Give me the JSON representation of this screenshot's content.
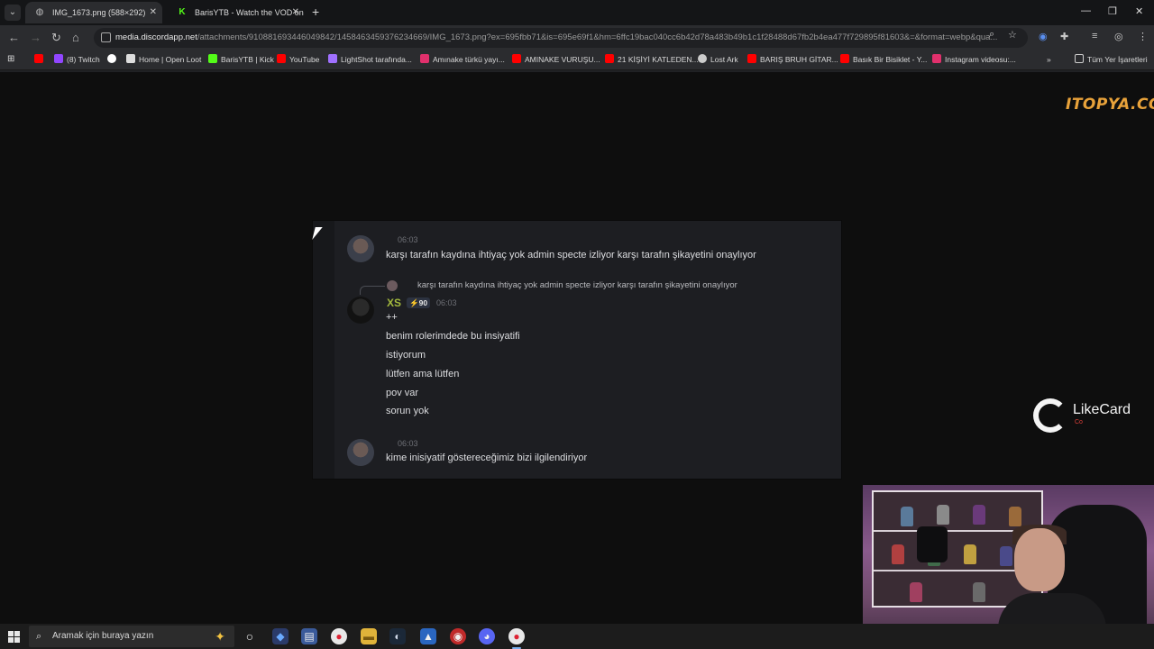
{
  "browser": {
    "tabs": [
      {
        "title": "IMG_1673.png (588×292)",
        "favicon": "globe-icon"
      },
      {
        "title": "BarisYTB - Watch the VOD on K",
        "favicon": "kick-icon"
      }
    ],
    "url_host": "media.discordapp.net",
    "url_path": "/attachments/910881693446049842/1458463459376234669/IMG_1673.png?ex=695fbb71&is=695e69f1&hm=6ffc19bac040cc6b42d78a483b49b1c1f28488d67fb2b4ea477f729895f81603&=&format=webp&qua...",
    "bookmarks": [
      {
        "label": "",
        "icon": "youtube-icon",
        "color": "#ff0000"
      },
      {
        "label": "(8) Twitch",
        "icon": "twitch-icon",
        "color": "#9146ff"
      },
      {
        "label": "",
        "icon": "google-icon",
        "color": "#ffffff"
      },
      {
        "label": "Home | Open Loot",
        "icon": "openloot-icon",
        "color": "#dddddd"
      },
      {
        "label": "BarisYTB | Kick",
        "icon": "kick-icon",
        "color": "#53fc18"
      },
      {
        "label": "YouTube",
        "icon": "youtube-icon",
        "color": "#ff0000"
      },
      {
        "label": "LightShot tarafında...",
        "icon": "lightshot-icon",
        "color": "#a070ff"
      },
      {
        "label": "Amınake türkü yayı...",
        "icon": "instagram-icon",
        "color": "#e1306c"
      },
      {
        "label": "AMINAKE VURUŞU...",
        "icon": "youtube-icon",
        "color": "#ff0000"
      },
      {
        "label": "21 KİŞİYİ KATLEDEN...",
        "icon": "youtube-icon",
        "color": "#ff0000"
      },
      {
        "label": "Lost Ark",
        "icon": "globe-icon",
        "color": "#cccccc"
      },
      {
        "label": "BARIŞ BRUH GİTAR...",
        "icon": "youtube-icon",
        "color": "#ff0000"
      },
      {
        "label": "Basık Bir Bisiklet - Y...",
        "icon": "youtube-icon",
        "color": "#ff0000"
      },
      {
        "label": "Instagram videosu:...",
        "icon": "instagram-icon",
        "color": "#e1306c"
      }
    ],
    "bookmarks_all": "Tüm Yer İşaretleri"
  },
  "overlay": {
    "itopya_logo": "ITOPYA.COM",
    "likecard_label": "LikeCard",
    "likecard_sub": "Co"
  },
  "chat": {
    "msg1": {
      "time": "06:03",
      "text": "karşı tarafın kaydına ihtiyaç yok admin specte izliyor karşı tarafın şikayetini onaylıyor"
    },
    "reply": {
      "text": "karşı tarafın kaydına ihtiyaç yok admin specte izliyor karşı tarafın şikayetini onaylıyor"
    },
    "msg2": {
      "username": "XS",
      "badge": "90",
      "time": "06:03",
      "lines": [
        "++",
        "benim rolerimdede bu insiyatifi",
        "istiyorum",
        "lütfen ama lütfen",
        "pov var",
        "sorun yok"
      ]
    },
    "msg3": {
      "time": "06:03",
      "text": "kime inisiyatif göstereceğimiz bizi ilgilendiriyor"
    }
  },
  "taskbar": {
    "search_placeholder": "Aramak için buraya yazın"
  }
}
